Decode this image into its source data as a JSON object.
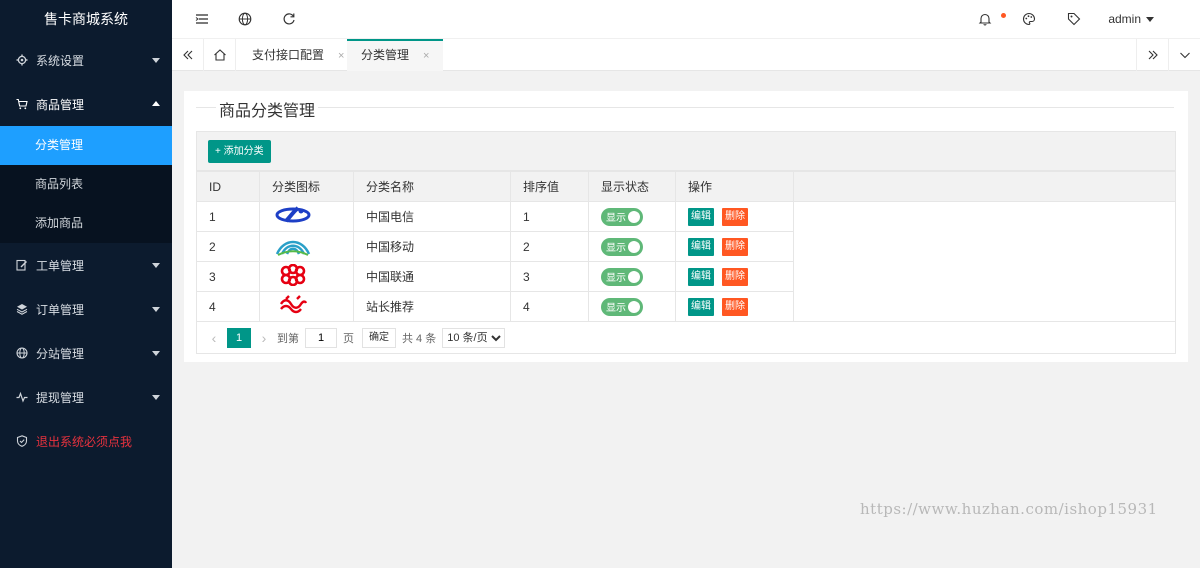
{
  "app": {
    "title": "售卡商城系统"
  },
  "sidebar": {
    "items": [
      {
        "label": "系统设置",
        "icon": "gear-icon"
      },
      {
        "label": "商品管理",
        "icon": "cart-icon"
      },
      {
        "label": "工单管理",
        "icon": "edit-icon"
      },
      {
        "label": "订单管理",
        "icon": "layers-icon"
      },
      {
        "label": "分站管理",
        "icon": "globe-icon"
      },
      {
        "label": "提现管理",
        "icon": "pulse-icon"
      },
      {
        "label": "退出系统必须点我",
        "icon": "shield-icon"
      }
    ],
    "sub_items": [
      {
        "label": "分类管理"
      },
      {
        "label": "商品列表"
      },
      {
        "label": "添加商品"
      }
    ]
  },
  "header": {
    "user": "admin",
    "notice_dot_color": "#ff5722"
  },
  "tabs": [
    {
      "label": "支付接口配置",
      "close": "×"
    },
    {
      "label": "分类管理",
      "close": "×"
    }
  ],
  "main": {
    "legend": "商品分类管理",
    "add_button": "+ 添加分类",
    "columns": [
      "ID",
      "分类图标",
      "分类名称",
      "排序值",
      "显示状态",
      "操作"
    ],
    "rows": [
      {
        "id": "1",
        "name": "中国电信",
        "sort": "1",
        "status": "显示",
        "logo": "telecom-logo-icon"
      },
      {
        "id": "2",
        "name": "中国移动",
        "sort": "2",
        "status": "显示",
        "logo": "mobile-logo-icon"
      },
      {
        "id": "3",
        "name": "中国联通",
        "sort": "3",
        "status": "显示",
        "logo": "unicom-logo-icon"
      },
      {
        "id": "4",
        "name": "站长推荐",
        "sort": "4",
        "status": "显示",
        "logo": "recommend-logo-icon"
      }
    ],
    "edit_label": "编辑",
    "delete_label": "删除"
  },
  "pager": {
    "current": "1",
    "goto_label": "到第",
    "goto_value": "1",
    "page_suffix": "页",
    "confirm": "确定",
    "total": "共 4 条",
    "page_size": "10 条/页"
  },
  "watermark": "https://www.huzhan.com/ishop15931",
  "colors": {
    "accent": "#009688",
    "sidebar_bg": "#0c1b2e",
    "active_blue": "#1e9fff",
    "danger": "#ff5722",
    "switch_on": "#5fb878"
  }
}
